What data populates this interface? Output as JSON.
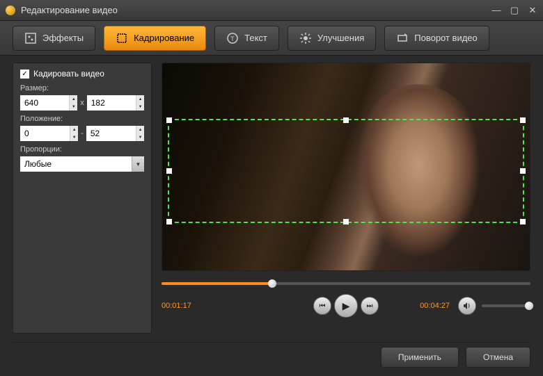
{
  "window": {
    "title": "Редактирование видео"
  },
  "toolbar": {
    "effects": "Эффекты",
    "crop": "Кадрирование",
    "text": "Текст",
    "enhance": "Улучшения",
    "rotate": "Поворот видео"
  },
  "sidebar": {
    "crop_checkbox": "Кадировать видео",
    "size_label": "Размер:",
    "size_w": "640",
    "size_h": "182",
    "size_sep": "x",
    "pos_label": "Положение:",
    "pos_x": "0",
    "pos_y": "52",
    "pos_sep": "-",
    "aspect_label": "Пропорции:",
    "aspect_value": "Любые"
  },
  "player": {
    "current_time": "00:01:17",
    "total_time": "00:04:27"
  },
  "footer": {
    "apply": "Применить",
    "cancel": "Отмена"
  }
}
